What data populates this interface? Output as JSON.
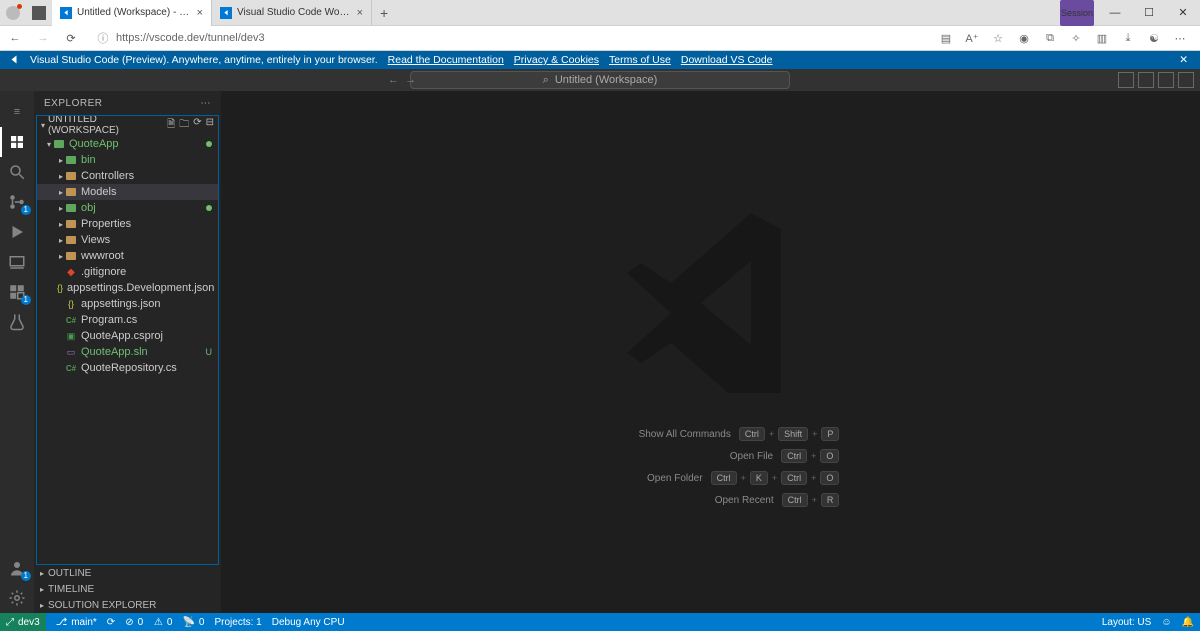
{
  "browser": {
    "tabs": [
      {
        "label": "Untitled (Workspace) - Visual St…",
        "active": true
      },
      {
        "label": "Visual Studio Code Workspace T…",
        "active": false
      }
    ],
    "window_controls": {
      "minimize": "—",
      "maximize": "☐",
      "close": "✕"
    },
    "url": "https://vscode.dev/tunnel/dev3",
    "scr": "Session"
  },
  "banner": {
    "text": "Visual Studio Code (Preview). Anywhere, anytime, entirely in your browser.",
    "links": [
      "Read the Documentation",
      "Privacy & Cookies",
      "Terms of Use",
      "Download VS Code"
    ]
  },
  "cmd_center": "Untitled (Workspace)",
  "explorer": {
    "title": "EXPLORER",
    "workspace": "UNTITLED (WORKSPACE)"
  },
  "tree": [
    {
      "d": 0,
      "label": "QuoteApp",
      "exp": true,
      "kind": "folder",
      "green": true,
      "dot": "g"
    },
    {
      "d": 1,
      "label": "bin",
      "exp": false,
      "kind": "folder",
      "green": true
    },
    {
      "d": 1,
      "label": "Controllers",
      "exp": false,
      "kind": "folder"
    },
    {
      "d": 1,
      "label": "Models",
      "exp": false,
      "kind": "folder",
      "sel": true
    },
    {
      "d": 1,
      "label": "obj",
      "exp": false,
      "kind": "folder",
      "green": true,
      "dot": "g"
    },
    {
      "d": 1,
      "label": "Properties",
      "exp": false,
      "kind": "folder"
    },
    {
      "d": 1,
      "label": "Views",
      "exp": false,
      "kind": "folder"
    },
    {
      "d": 1,
      "label": "wwwroot",
      "exp": false,
      "kind": "folder"
    },
    {
      "d": 1,
      "label": ".gitignore",
      "kind": "git"
    },
    {
      "d": 1,
      "label": "appsettings.Development.json",
      "kind": "json"
    },
    {
      "d": 1,
      "label": "appsettings.json",
      "kind": "json"
    },
    {
      "d": 1,
      "label": "Program.cs",
      "kind": "cs"
    },
    {
      "d": 1,
      "label": "QuoteApp.csproj",
      "kind": "csproj"
    },
    {
      "d": 1,
      "label": "QuoteApp.sln",
      "kind": "sln",
      "green": true,
      "badge": "U"
    },
    {
      "d": 1,
      "label": "QuoteRepository.cs",
      "kind": "cs"
    }
  ],
  "sidebar_panels": [
    "OUTLINE",
    "TIMELINE",
    "SOLUTION EXPLORER"
  ],
  "hints": [
    {
      "label": "Show All Commands",
      "keys": [
        "Ctrl",
        "Shift",
        "P"
      ]
    },
    {
      "label": "Open File",
      "keys": [
        "Ctrl",
        "O"
      ]
    },
    {
      "label": "Open Folder",
      "keys": [
        "Ctrl",
        "K",
        "Ctrl",
        "O"
      ]
    },
    {
      "label": "Open Recent",
      "keys": [
        "Ctrl",
        "R"
      ]
    }
  ],
  "status": {
    "remote": "dev3",
    "branch": "main*",
    "sync": "⟳",
    "errors": "0",
    "warnings": "0",
    "port": "0",
    "projects": "Projects: 1",
    "debug": "Debug Any CPU",
    "layout": "Layout: US"
  }
}
